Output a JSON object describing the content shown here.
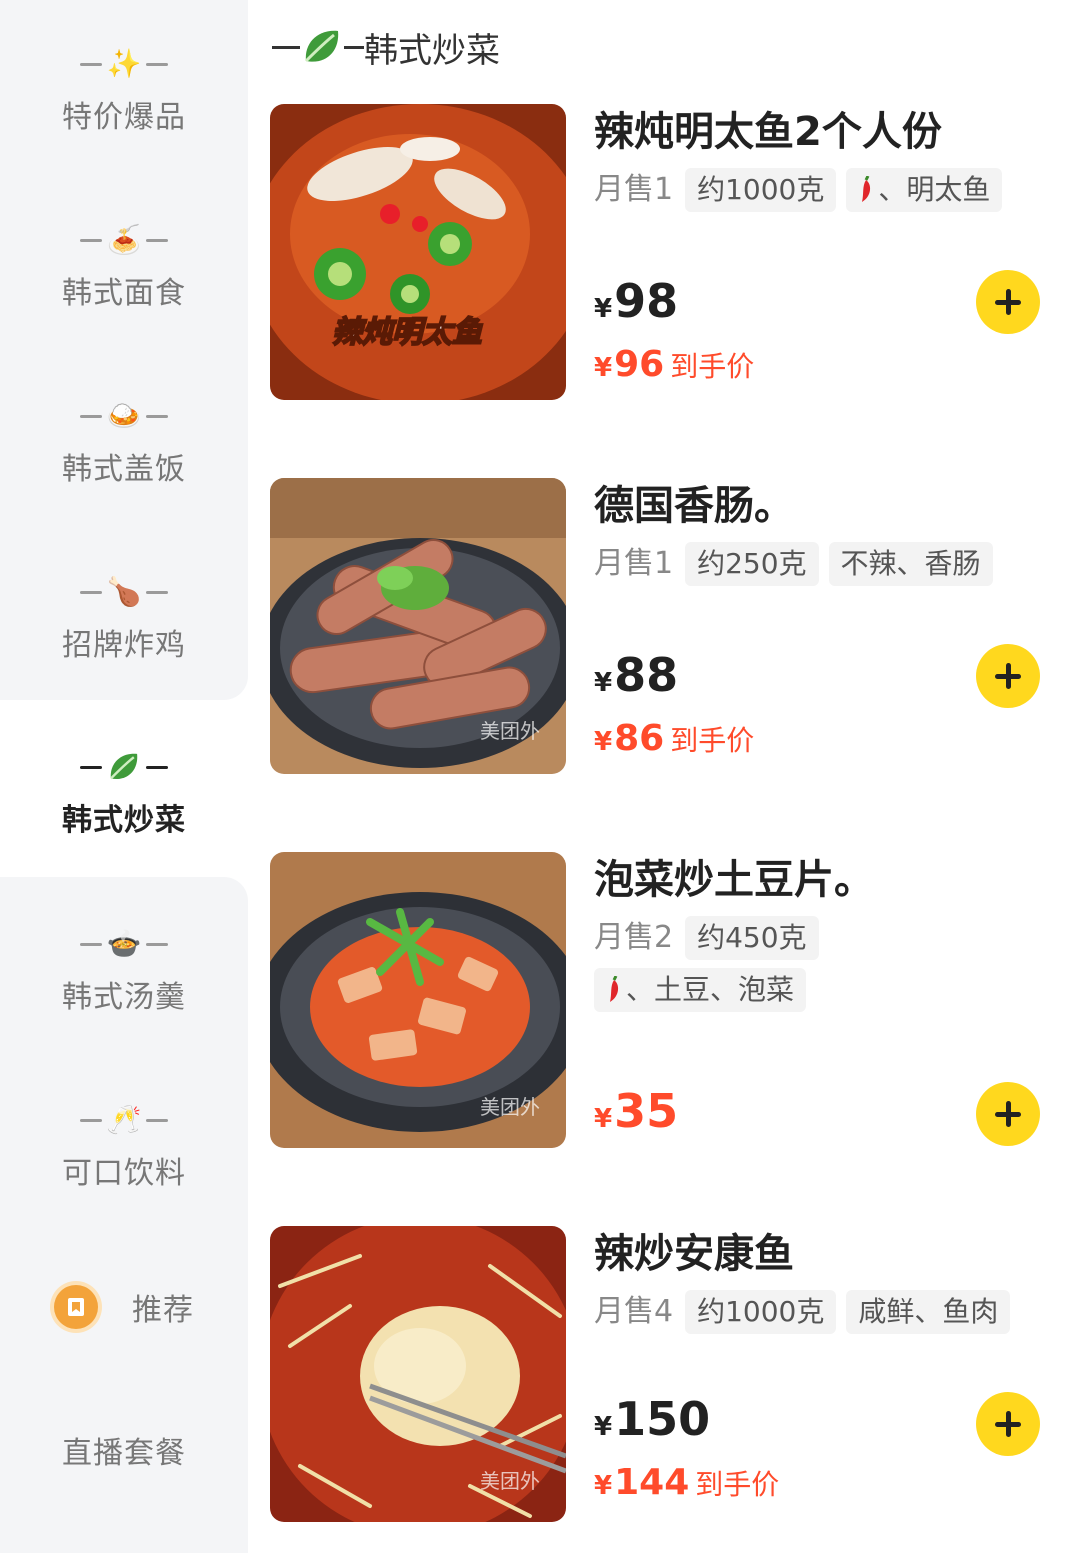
{
  "sidebar": {
    "items": [
      {
        "label": "特价爆品",
        "icon": "sparkles-icon",
        "emoji": "✨"
      },
      {
        "label": "韩式面食",
        "icon": "noodle-bowl-icon",
        "emoji": "🍝"
      },
      {
        "label": "韩式盖饭",
        "icon": "curry-rice-icon",
        "emoji": "🍛"
      },
      {
        "label": "招牌炸鸡",
        "icon": "chicken-leg-icon",
        "emoji": "🍗"
      },
      {
        "label": "韩式炒菜",
        "icon": "leafy-green-icon",
        "emoji": "🥬"
      },
      {
        "label": "韩式汤羹",
        "icon": "soup-bowl-icon",
        "emoji": "🍲"
      },
      {
        "label": "可口饮料",
        "icon": "clinking-glasses-icon",
        "emoji": "🥂"
      },
      {
        "label": "推荐",
        "icon": "recommend-bookmark-icon"
      },
      {
        "label": "直播套餐"
      }
    ],
    "active_index": 4
  },
  "section": {
    "title": "韩式炒菜",
    "icon": "leafy-green-icon"
  },
  "products": [
    {
      "name": "辣炖明太鱼2个人份",
      "sold": "月售1",
      "tags": [
        "约1000克",
        "、明太鱼"
      ],
      "tag_has_chili": [
        false,
        true
      ],
      "price": "98",
      "deal_price": "96",
      "deal_suffix": "到手价",
      "image_caption": "辣炖明太鱼"
    },
    {
      "name": "德国香肠。",
      "sold": "月售1",
      "tags": [
        "约250克",
        "不辣、香肠"
      ],
      "tag_has_chili": [
        false,
        false
      ],
      "price": "88",
      "deal_price": "86",
      "deal_suffix": "到手价",
      "watermark": "美团外"
    },
    {
      "name": "泡菜炒土豆片。",
      "sold": "月售2",
      "tags": [
        "约450克",
        "、土豆、泡菜"
      ],
      "tag_has_chili": [
        false,
        true
      ],
      "price": "35",
      "watermark": "美团外"
    },
    {
      "name": "辣炒安康鱼",
      "sold": "月售4",
      "tags": [
        "约1000克",
        "咸鲜、鱼肉"
      ],
      "tag_has_chili": [
        false,
        false
      ],
      "price": "150",
      "deal_price": "144",
      "deal_suffix": "到手价",
      "watermark": "美团外"
    }
  ],
  "currency": "¥",
  "colors": {
    "accent_yellow": "#ffd81e",
    "deal_red": "#ff4b2b",
    "sidebar_bg": "#f4f5f7"
  }
}
